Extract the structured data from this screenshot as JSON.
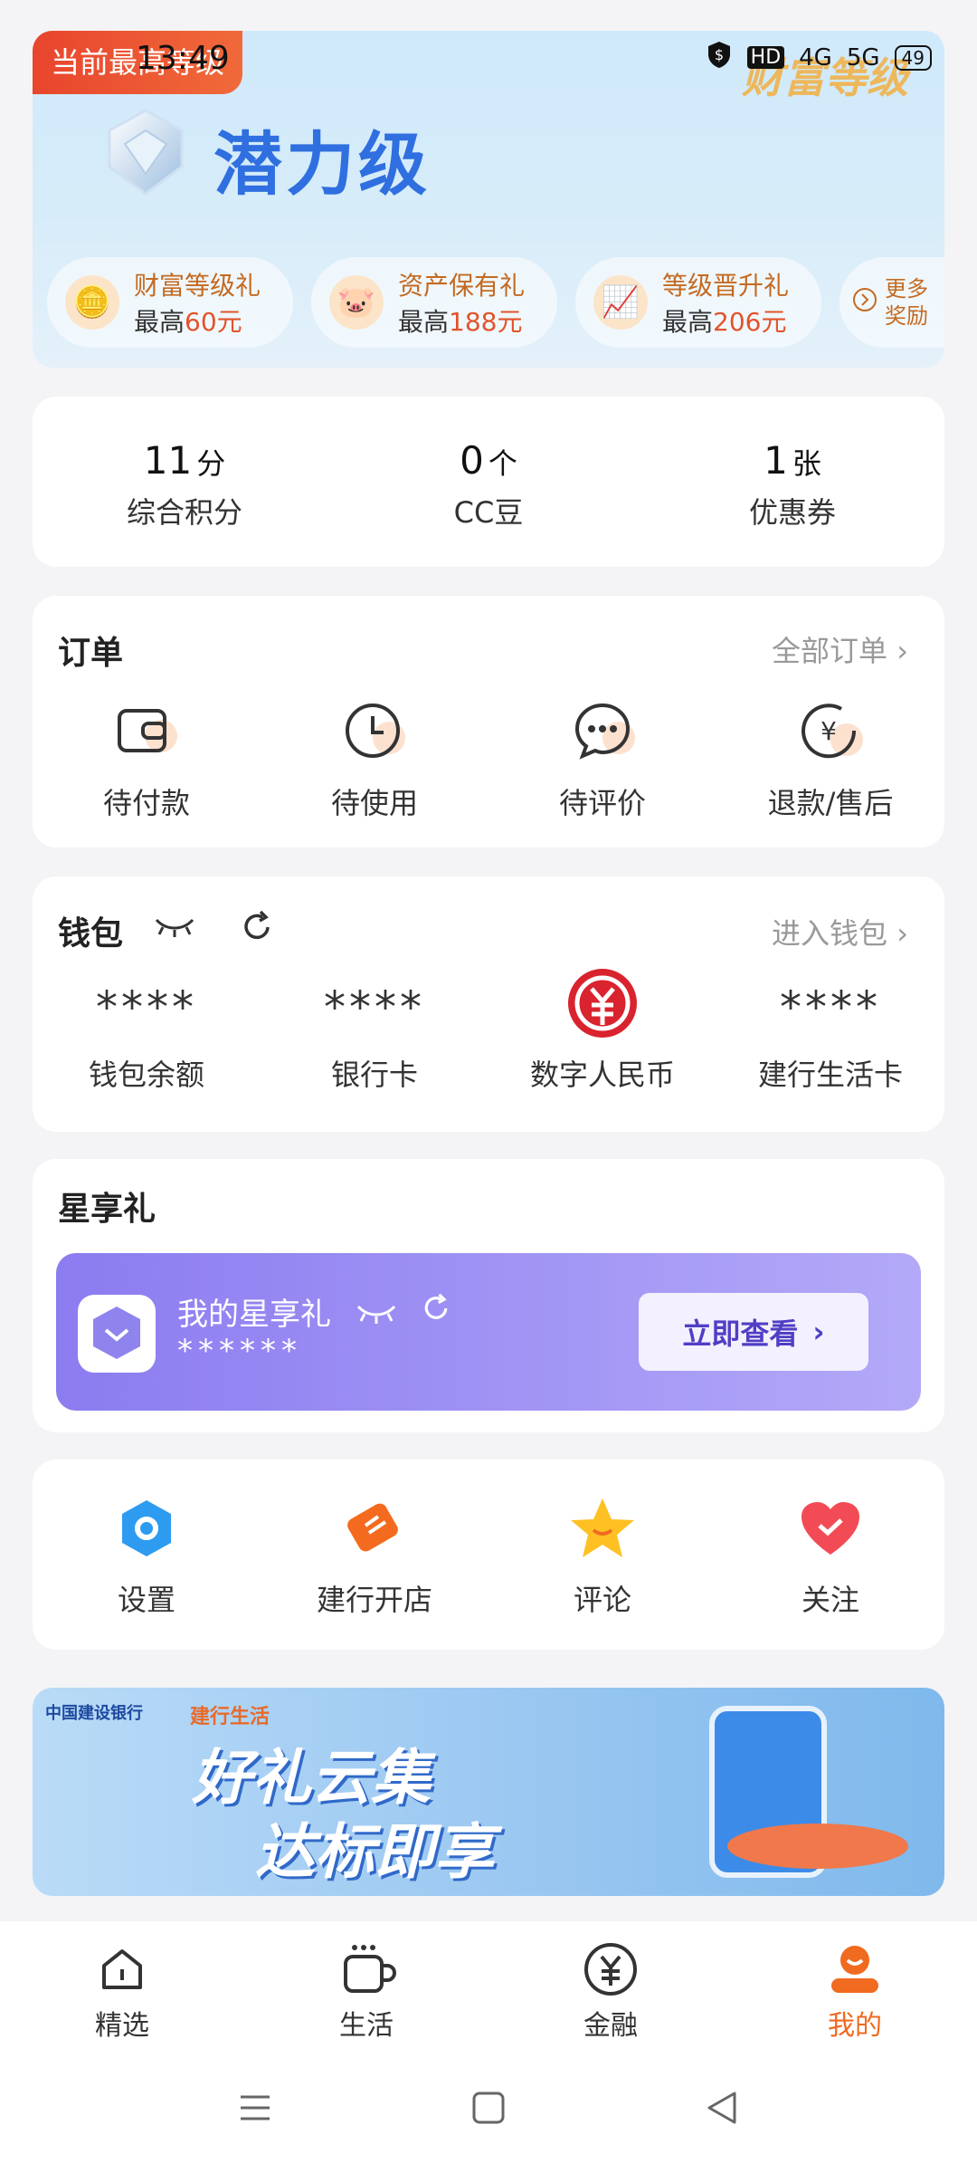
{
  "status_bar": {
    "time": "13:49",
    "signal": "4G",
    "signal2": "5G",
    "battery": "49"
  },
  "header": {
    "current_tag": "当前最高等级",
    "wealth_watermark": "财富等级",
    "level": "潜力级",
    "perks": [
      {
        "title": "财富等级礼",
        "prefix": "最高",
        "amount": "60元"
      },
      {
        "title": "资产保有礼",
        "prefix": "最高",
        "amount": "188元"
      },
      {
        "title": "等级晋升礼",
        "prefix": "最高",
        "amount": "206元"
      }
    ],
    "more": {
      "line1": "更多",
      "line2": "奖励"
    }
  },
  "points": [
    {
      "value": "11",
      "unit": "分",
      "label": "综合积分"
    },
    {
      "value": "0",
      "unit": "个",
      "label": "CC豆"
    },
    {
      "value": "1",
      "unit": "张",
      "label": "优惠券"
    }
  ],
  "orders": {
    "title": "订单",
    "link": "全部订单",
    "items": [
      {
        "label": "待付款",
        "icon": "wallet-icon"
      },
      {
        "label": "待使用",
        "icon": "clock-icon"
      },
      {
        "label": "待评价",
        "icon": "chat-icon"
      },
      {
        "label": "退款/售后",
        "icon": "refund-icon"
      }
    ]
  },
  "wallet": {
    "title": "钱包",
    "link": "进入钱包",
    "items": [
      {
        "value": "****",
        "label": "钱包余额"
      },
      {
        "value": "****",
        "label": "银行卡"
      },
      {
        "value": "",
        "label": "数字人民币"
      },
      {
        "value": "****",
        "label": "建行生活卡"
      }
    ]
  },
  "xingxiang": {
    "title": "星享礼",
    "card_title": "我的星享礼",
    "masked": "******",
    "button": "立即查看"
  },
  "tools": [
    {
      "label": "设置",
      "icon": "settings-icon"
    },
    {
      "label": "建行开店",
      "icon": "shop-icon"
    },
    {
      "label": "评论",
      "icon": "star-icon"
    },
    {
      "label": "关注",
      "icon": "heart-icon"
    }
  ],
  "banner": {
    "bank": "中国建设银行",
    "brand": "建行生活",
    "line1": "好礼云集",
    "line2": "达标即享"
  },
  "tabbar": [
    {
      "label": "精选",
      "icon": "home-icon"
    },
    {
      "label": "生活",
      "icon": "cup-icon"
    },
    {
      "label": "金融",
      "icon": "yen-icon"
    },
    {
      "label": "我的",
      "icon": "profile-icon"
    }
  ],
  "colors": {
    "accent": "#f06a1f",
    "level_blue": "#2f6fe0",
    "red": "#e2532b",
    "purple": "#8b7cf0"
  }
}
